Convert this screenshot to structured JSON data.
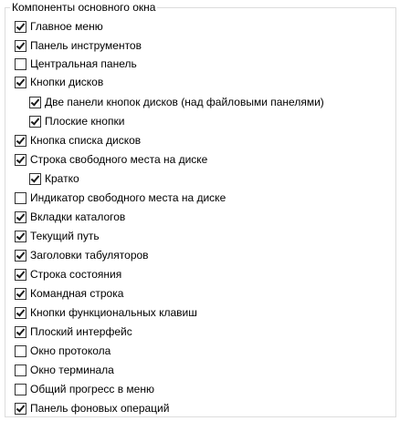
{
  "group": {
    "title": "Компоненты основного окна"
  },
  "options": [
    {
      "label": "Главное меню",
      "checked": true
    },
    {
      "label": "Панель инструментов",
      "checked": true
    },
    {
      "label": "Центральная панель",
      "checked": false
    },
    {
      "label": "Кнопки дисков",
      "checked": true
    },
    {
      "label": "Две панели кнопок дисков (над файловыми панелями)",
      "checked": true
    },
    {
      "label": "Плоские кнопки",
      "checked": true
    },
    {
      "label": "Кнопка списка дисков",
      "checked": true
    },
    {
      "label": "Строка свободного места на диске",
      "checked": true
    },
    {
      "label": "Кратко",
      "checked": true
    },
    {
      "label": "Индикатор свободного места на диске",
      "checked": false
    },
    {
      "label": "Вкладки каталогов",
      "checked": true
    },
    {
      "label": "Текущий путь",
      "checked": true
    },
    {
      "label": "Заголовки табуляторов",
      "checked": true
    },
    {
      "label": "Строка состояния",
      "checked": true
    },
    {
      "label": "Командная строка",
      "checked": true
    },
    {
      "label": "Кнопки функциональных клавиш",
      "checked": true
    },
    {
      "label": "Плоский интерфейс",
      "checked": true
    },
    {
      "label": "Окно протокола",
      "checked": false
    },
    {
      "label": "Окно терминала",
      "checked": false
    },
    {
      "label": "Общий прогресс в меню",
      "checked": false
    },
    {
      "label": "Панель фоновых операций",
      "checked": true
    }
  ]
}
